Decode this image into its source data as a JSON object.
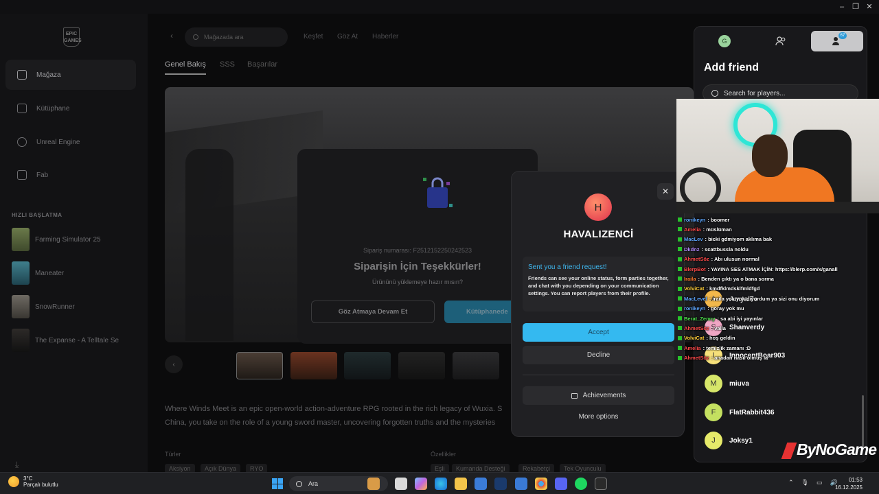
{
  "sidebar": {
    "logo_text": "EPIC GAMES",
    "nav": [
      {
        "label": "Mağaza",
        "icon": "store-icon"
      },
      {
        "label": "Kütüphane",
        "icon": "library-icon"
      },
      {
        "label": "Unreal Engine",
        "icon": "unreal-icon"
      },
      {
        "label": "Fab",
        "icon": "fab-icon"
      }
    ],
    "quick_launch_title": "HIZLI BAŞLATMA",
    "quick_launch": [
      {
        "label": "Farming Simulator 25"
      },
      {
        "label": "Maneater"
      },
      {
        "label": "SnowRunner"
      },
      {
        "label": "The Expanse - A Telltale Se"
      }
    ]
  },
  "store": {
    "search_placeholder": "Mağazada ara",
    "top_links": [
      "Keşfet",
      "Göz At",
      "Haberler"
    ],
    "subtabs": [
      "Genel Bakış",
      "SSS",
      "Başarılar"
    ],
    "description": "Where Winds Meet is an epic open-world action-adventure RPG rooted in the rich legacy of Wuxia. S China, you take on the role of a young sword master, uncovering forgotten truths and the mysteries",
    "genres_label": "Türler",
    "genres": [
      "Aksiyon",
      "Açık Dünya",
      "RYO"
    ],
    "features_label": "Özellikler",
    "features": [
      "Eşli",
      "Kumanda Desteği",
      "Rekabetçi",
      "Tek Oyunculu"
    ]
  },
  "order_modal": {
    "order_number": "Sipariş numarası: F2512152250242523",
    "title": "Siparişin İçin Teşekkürler!",
    "subtitle": "Ürününü yüklemeye hazır mısın?",
    "continue_label": "Göz Atmaya Devam Et",
    "library_label": "Kütüphanede"
  },
  "friend_dialog": {
    "avatar_letter": "H",
    "name": "HAVALIZENCİ",
    "request_title": "Sent you a friend request!",
    "request_body": "Friends can see your online status, form parties together, and chat with you depending on your communication settings. You can report players from their profile.",
    "accept_label": "Accept",
    "decline_label": "Decline",
    "achievements_label": "Achievements",
    "more_options_label": "More options",
    "close_symbol": "✕"
  },
  "friends_panel": {
    "profile_letter": "G",
    "badge_count": "67",
    "title": "Add friend",
    "search_placeholder": "Search for players...",
    "friends": [
      {
        "name": "Amyal7e",
        "letter": "A",
        "color": "#f2b84b"
      },
      {
        "name": "Shanverdy",
        "letter": "S",
        "color": "#f0a6c4"
      },
      {
        "name": "InnocentBoar903",
        "letter": "I",
        "color": "#f6e07a"
      },
      {
        "name": "miuva",
        "letter": "M",
        "color": "#d7e66a"
      },
      {
        "name": "FlatRabbit436",
        "letter": "F",
        "color": "#c4e060"
      },
      {
        "name": "Joksy1",
        "letter": "J",
        "color": "#e6ea6a"
      }
    ]
  },
  "chat": [
    {
      "user": "ronikeyn",
      "color": "#5ea7ff",
      "msg": ": boomer"
    },
    {
      "user": "Amelia",
      "color": "#ff4a4a",
      "msg": ": müslüman"
    },
    {
      "user": "MacLev",
      "color": "#5ea7ff",
      "msg": ": bicki gdmiyom aklıma bak"
    },
    {
      "user": "Dkdnz",
      "color": "#b48cff",
      "msg": ": scattbussla noldu"
    },
    {
      "user": "AhmetSöz",
      "color": "#ff4a4a",
      "msg": ": Abı ulusun normal"
    },
    {
      "user": "BlerpBot",
      "color": "#ff4a4a",
      "msg": ": YAYINA SES ATMAK İÇİN: https://blerp.com/x/ganall"
    },
    {
      "user": "Iraila",
      "color": "#ff7a2e",
      "msg": ": Benden çıktı ya o bana sorma"
    },
    {
      "user": "VolviCat",
      "color": "#ffcf3a",
      "msg": ": kmdfklmdsklfmldfgd"
    },
    {
      "user": "MacLevel",
      "color": "#5ea7ff",
      "msg": ": iraila yok yok diyordum ya sizi onu diyorum"
    },
    {
      "user": "ronikeyn",
      "color": "#5ea7ff",
      "msg": ": göray yok mu"
    },
    {
      "user": "Berat_Zenny",
      "color": "#4ddf4d",
      "msg": ": sa abi iyi yayınlar"
    },
    {
      "user": "AhmetSöz",
      "color": "#ff4a4a",
      "msg": ": valla"
    },
    {
      "user": "VolviCat",
      "color": "#ffcf3a",
      "msg": ": hoş geldin"
    },
    {
      "user": "Amelia",
      "color": "#ff4a4a",
      "msg": ": temizlik zamanı :D"
    },
    {
      "user": "AhmetSöz",
      "color": "#ff4a4a",
      "msg": ": anadan nasıl olmuş la"
    }
  ],
  "watermark": "ByNoGame",
  "taskbar": {
    "temperature": "3°C",
    "weather": "Parçalı bulutlu",
    "search_label": "Ara",
    "time": "01:53",
    "date": "16.12.2025"
  }
}
